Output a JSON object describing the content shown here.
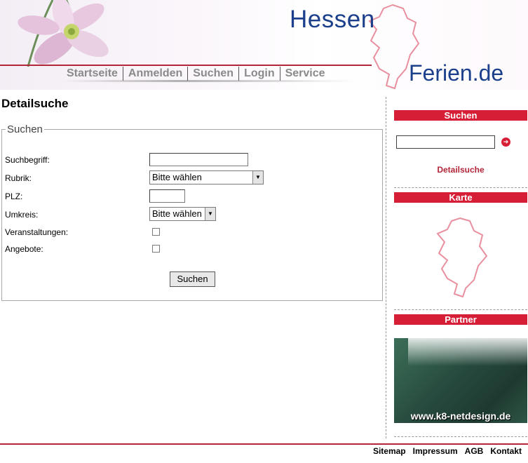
{
  "header": {
    "logo_line1": "Hessen",
    "logo_line2": "Ferien.de",
    "nav": [
      "Startseite",
      "Anmelden",
      "Suchen",
      "Login",
      "Service"
    ],
    "accent_color": "#b3263a",
    "logo_color": "#1b3f8b"
  },
  "main": {
    "title": "Detailsuche",
    "fieldset_legend": "Suchen",
    "fields": {
      "suchbegriff_label": "Suchbegriff:",
      "suchbegriff_value": "",
      "rubrik_label": "Rubrik:",
      "rubrik_selected": "Bitte wählen",
      "plz_label": "PLZ:",
      "plz_value": "",
      "umkreis_label": "Umkreis:",
      "umkreis_selected": "Bitte wählen",
      "veranstaltungen_label": "Veranstaltungen:",
      "angebote_label": "Angebote:"
    },
    "submit_label": "Suchen"
  },
  "sidebar": {
    "search_header": "Suchen",
    "search_value": "",
    "detail_link": "Detailsuche",
    "map_header": "Karte",
    "partner_header": "Partner",
    "partner_text": "www.k8-netdesign.de",
    "header_color": "#d61f37"
  },
  "footer": {
    "links": [
      "Sitemap",
      "Impressum",
      "AGB",
      "Kontakt"
    ]
  }
}
